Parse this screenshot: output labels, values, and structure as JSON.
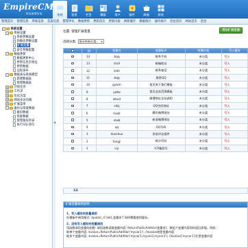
{
  "header": {
    "logo": "EmpireCMS",
    "logo_sub": "网站管理系统",
    "tabs": [
      {
        "label": "系统",
        "icon": "computer-icon",
        "active": true
      },
      {
        "label": "信息",
        "icon": "info-icon",
        "active": false
      },
      {
        "label": "栏目",
        "icon": "column-icon",
        "active": false
      },
      {
        "label": "模板",
        "icon": "template-icon",
        "active": false
      },
      {
        "label": "用户",
        "icon": "user-icon",
        "active": false
      },
      {
        "label": "插件",
        "icon": "plugin-icon",
        "active": false
      },
      {
        "label": "商城",
        "icon": "shop-icon",
        "active": false
      },
      {
        "label": "其他",
        "icon": "other-icon",
        "active": false
      }
    ]
  },
  "subnav": [
    "管理首页",
    "管理信息",
    "审核信息",
    "签发信息",
    "管理评论",
    "数据更新",
    "更新首页",
    "更新内容",
    "刷新缓存",
    "数据统计",
    "操作统计",
    "后台首页",
    "网站首页",
    "后台"
  ],
  "sidebar": {
    "items": [
      {
        "label": "系统设置",
        "level": 0,
        "type": "folder",
        "toggle": "-",
        "bold": true
      },
      {
        "label": "系统设置",
        "level": 1,
        "type": "folder",
        "toggle": "-"
      },
      {
        "label": "系统参数设置",
        "level": 2,
        "type": "page"
      },
      {
        "label": "伪静态参数设置",
        "level": 2,
        "type": "page"
      },
      {
        "label": "扩展变量",
        "level": 2,
        "type": "page",
        "selected": true
      },
      {
        "label": "安全参数配置",
        "level": 2,
        "type": "page"
      },
      {
        "label": "数据更新",
        "level": 1,
        "type": "folder",
        "toggle": "-"
      },
      {
        "label": "数据更新中心",
        "level": 2,
        "type": "page"
      },
      {
        "label": "更新信息页地址",
        "level": 2,
        "type": "page"
      },
      {
        "label": "更新数据",
        "level": 2,
        "type": "page"
      },
      {
        "label": "远程发布",
        "level": 2,
        "type": "page"
      },
      {
        "label": "数据表与系统模型",
        "level": 1,
        "type": "folder",
        "toggle": "-"
      },
      {
        "label": "新建数据表",
        "level": 2,
        "type": "page"
      },
      {
        "label": "管理数据表",
        "level": 2,
        "type": "page"
      },
      {
        "label": "计划任务",
        "level": 1,
        "type": "folder",
        "toggle": "+"
      },
      {
        "label": "工作流",
        "level": 1,
        "type": "folder",
        "toggle": "+"
      },
      {
        "label": "优化方案",
        "level": 1,
        "type": "folder",
        "toggle": "+"
      },
      {
        "label": "网站多访问端",
        "level": 1,
        "type": "folder",
        "toggle": "+"
      },
      {
        "label": "扩展菜单",
        "level": 1,
        "type": "folder",
        "toggle": "+"
      },
      {
        "label": "备份与恢复数据",
        "level": 1,
        "type": "folder",
        "toggle": "-"
      },
      {
        "label": "备份数据",
        "level": 2,
        "type": "page"
      },
      {
        "label": "恢复数据",
        "level": 2,
        "type": "page"
      },
      {
        "label": "管理备份目录",
        "level": 2,
        "type": "page"
      },
      {
        "label": "执行SQL语句",
        "level": 2,
        "type": "page"
      }
    ]
  },
  "main": {
    "breadcrumb": "位置: 管理扩展变量",
    "add_button": "增加扩展变量",
    "filter_label": "选择分类:",
    "filter_value": "显示所有分类",
    "table": {
      "headers": [
        "ID",
        "变量名",
        "变量标识",
        "所属分类",
        "写入缓存"
      ],
      "rows": [
        {
          "id": "14",
          "name": "bqq",
          "title": "联系手机",
          "cat": "未分类",
          "op": "写入"
        },
        {
          "id": "13",
          "name": "mail",
          "title": "邮箱地址",
          "cat": "未分类",
          "op": "写入"
        },
        {
          "id": "12",
          "name": "ledh",
          "title": "联系电话",
          "cat": "未分类",
          "op": "写入"
        },
        {
          "id": "11",
          "name": "bqq",
          "title": "联系QQ",
          "cat": "未分类",
          "op": "写入"
        },
        {
          "id": "10",
          "name": "gywm",
          "title": "首页关于我们模板",
          "cat": "未分类",
          "op": "写入"
        },
        {
          "id": "9",
          "name": "ywfw",
          "title": "首页业务范围模板",
          "cat": "未分类",
          "op": "写入"
        },
        {
          "id": "8",
          "name": "wbud",
          "title": "微博地址全站调用",
          "cat": "未分类",
          "op": "写入"
        },
        {
          "id": "7",
          "name": "sdsj",
          "title": "QQ空间地址",
          "cat": "未分类",
          "op": "写入"
        },
        {
          "id": "6",
          "name": "txwb",
          "title": "腾讯微博地址",
          "cat": "未分类",
          "op": "写入"
        },
        {
          "id": "5",
          "name": "xlwb",
          "title": "新浪微博地址",
          "cat": "未分类",
          "op": "写入"
        },
        {
          "id": "4",
          "name": "qq",
          "title": "QQ号码",
          "cat": "未分类",
          "op": "写入"
        },
        {
          "id": "3",
          "name": "duoshuo",
          "title": "多说评论插件",
          "cat": "未分类",
          "op": "写入"
        },
        {
          "id": "2",
          "name": "tongji",
          "title": "统计代码",
          "cat": "未分类",
          "op": "写入"
        },
        {
          "id": "1",
          "name": "icp",
          "title": "ICP备案号",
          "cat": "未分类",
          "op": "写入"
        }
      ]
    },
    "pager": "14"
  },
  "panel": {
    "title": "扩展变量调用说明",
    "section1_title": "1、写入缓存的变量调用",
    "section1_body": "在模板中调用格式: $public_r['add_变量名'] 同时需要使用缓存。",
    "section2_title": "2、没有写入缓存的变量调用",
    "section2_lines": [
      "用函数调用变量的函数: 调用函数读取变量内容: ReturnPublicAddVar(变量名)，数组个变量内容同时返回多值，例如:",
      "取单个变量内容: $value=ReturnPublicAddVar('myvar1'); //$value就是变量内容",
      "取多个变量内容: $value=ReturnPublicAddVar('myvar1,myvar2,myvar3'); //$value['myvar1']才是变量内容"
    ]
  },
  "colors": {
    "header": "#2f7fd0",
    "accent_red": "#cc0000",
    "add_button": "#4c9f35"
  }
}
